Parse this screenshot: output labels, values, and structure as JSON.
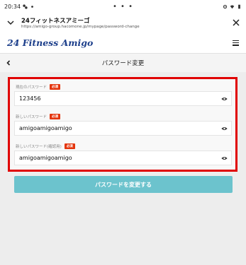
{
  "statusbar": {
    "time": "20:34",
    "center_dots": "• • •"
  },
  "appbar": {
    "title": "24フィットネスアミーゴ",
    "url": "https://amigo-group.hacomone.jp/mypage/password-change"
  },
  "brand": {
    "logo_text": "24 Fitness Amigo"
  },
  "page": {
    "title": "パスワード変更"
  },
  "form": {
    "fields": [
      {
        "label": "現在のパスワード",
        "required": "必須",
        "value": "123456"
      },
      {
        "label": "新しいパスワード",
        "required": "必須",
        "value": "amigoamigoamigo"
      },
      {
        "label": "新しいパスワード(確認用)",
        "required": "必須",
        "value": "amigoamigoamigo"
      }
    ],
    "submit_label": "パスワードを変更する"
  },
  "colors": {
    "brand": "#1d3f8b",
    "required_badge": "#e4350d",
    "highlight_border": "#e00000",
    "submit_button": "#6cc3cd"
  }
}
